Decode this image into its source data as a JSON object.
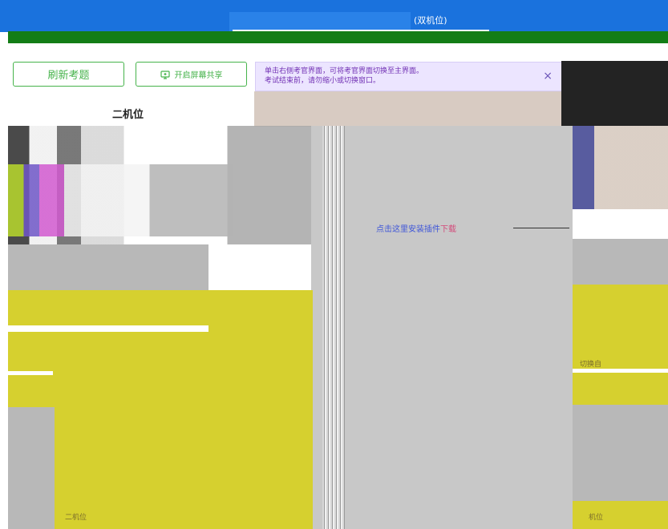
{
  "header": {
    "title_suffix": "(双机位)"
  },
  "left_panel": {
    "refresh_button": "刷新考题",
    "share_button": "开启屏幕共享",
    "title": "二机位"
  },
  "notice": {
    "line1": "单击右侧考官界面，可将考官界面切换至主界面。",
    "line2": "考试结束前，请勿缩小或切换窗口。",
    "close": "×"
  },
  "main": {
    "download_prefix": "点击这里安装插件",
    "download_link": "下载"
  },
  "labels": {
    "right_label": "切换自",
    "bottom_left": "二机位",
    "bottom_right": "机位"
  },
  "colors": {
    "header_blue": "#1a72dd",
    "header_green": "#137d16",
    "accent_green": "#46b34b",
    "notice_bg": "#ece5ff",
    "notice_text": "#7232b4"
  },
  "icons": {
    "share": "screen-share-icon",
    "close": "close-icon"
  }
}
